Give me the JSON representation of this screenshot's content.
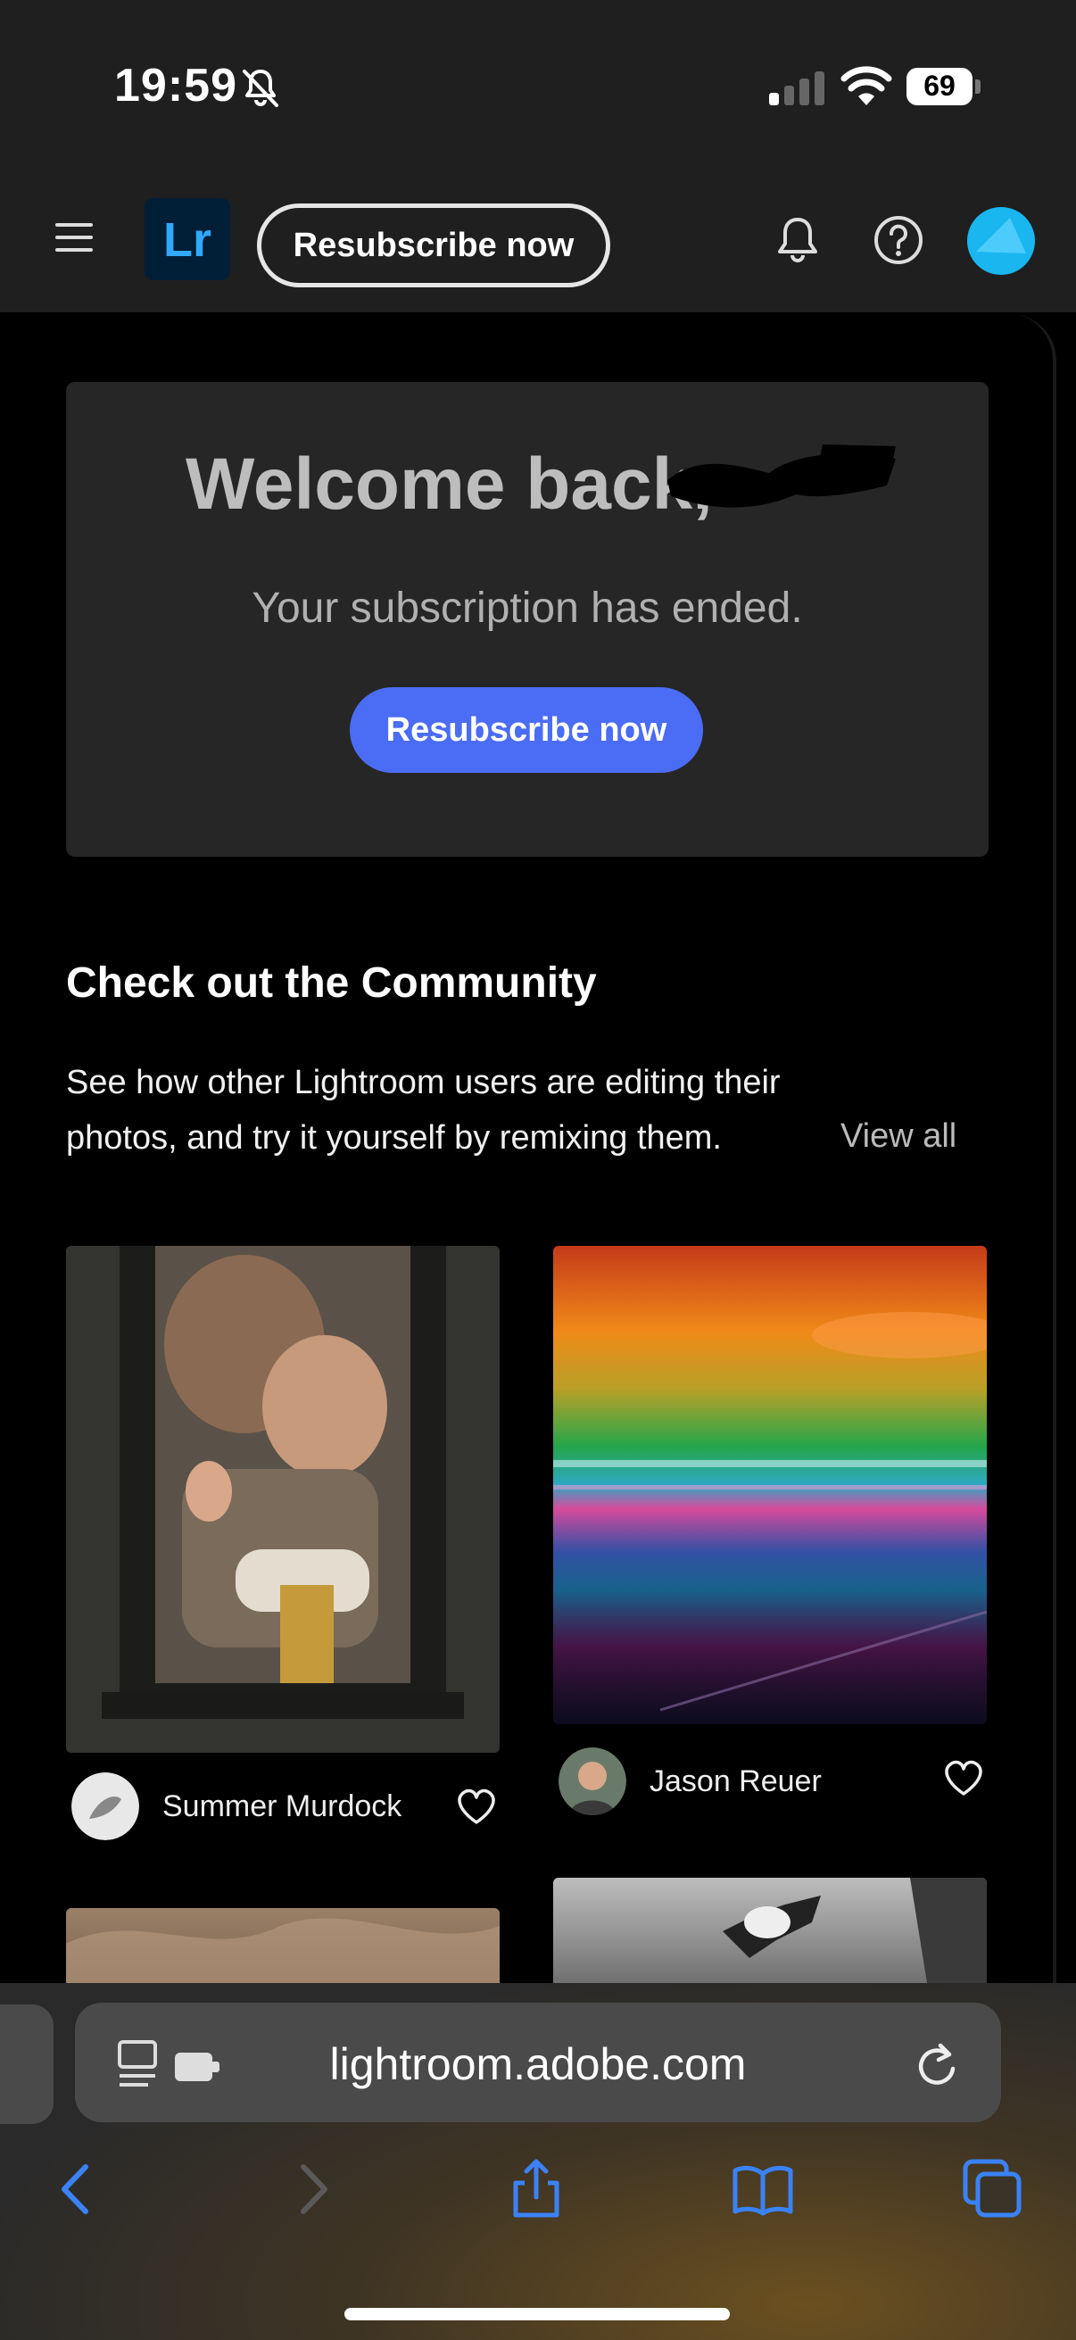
{
  "status_bar": {
    "time": "19:59",
    "battery": "69",
    "icons": [
      "bell-slash-icon",
      "signal-icon",
      "wifi-icon",
      "battery-icon"
    ]
  },
  "header": {
    "logo": "Lr",
    "resubscribe_label": "Resubscribe now",
    "icons": [
      "menu-icon",
      "bell-icon",
      "help-icon",
      "avatar"
    ]
  },
  "welcome": {
    "title": "Welcome back,",
    "subtitle": "Your subscription has ended.",
    "button_label": "Resubscribe now"
  },
  "community": {
    "title": "Check out the Community",
    "description": "See how other Lightroom users are editing their photos, and try it yourself by remixing them.",
    "view_all": "View all",
    "items": [
      {
        "author": "Summer Murdock"
      },
      {
        "author": "Jason Reuer"
      }
    ]
  },
  "browser": {
    "url": "lightroom.adobe.com",
    "icons": [
      "back-icon",
      "forward-icon",
      "share-icon",
      "bookmarks-icon",
      "tabs-icon",
      "reload-icon"
    ]
  },
  "colors": {
    "accent_blue": "#4b6cf5",
    "lr_brand_bg": "#001e36",
    "lr_brand_fg": "#31a8ff",
    "avatar": "#1ab6f0"
  }
}
